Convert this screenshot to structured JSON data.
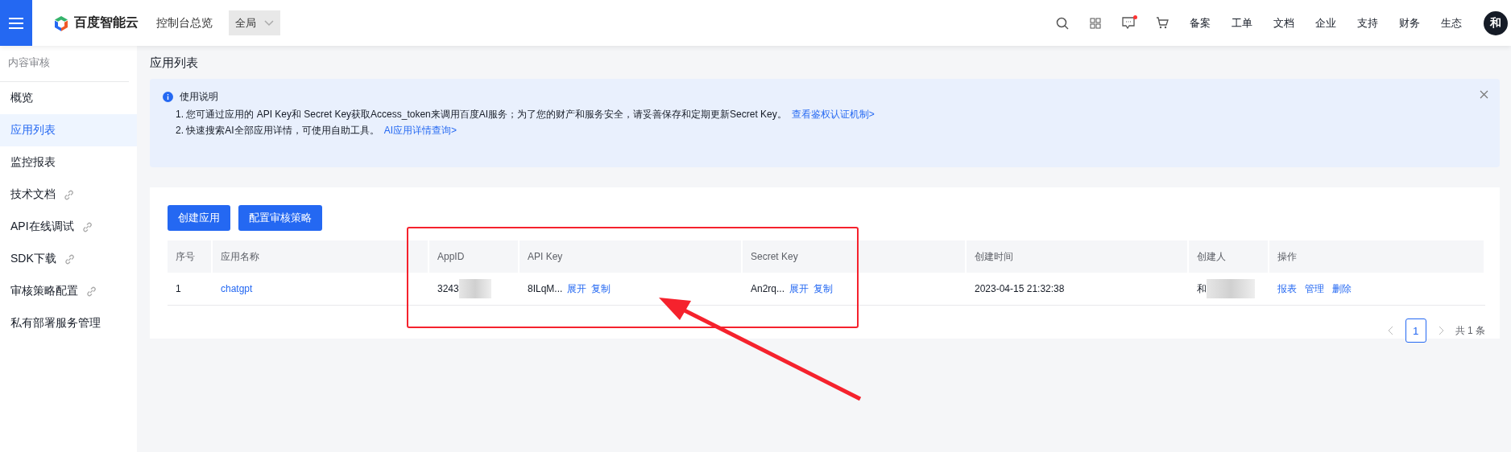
{
  "topbar": {
    "logo": "百度智能云",
    "console": "控制台总览",
    "region": {
      "value": "全局"
    },
    "notification_dot": true,
    "nav": [
      "备案",
      "工单",
      "文档",
      "企业",
      "支持",
      "财务",
      "生态"
    ],
    "avatar": "和"
  },
  "sidebar": {
    "title": "内容审核",
    "items": [
      {
        "label": "概览",
        "selected": false,
        "external": false
      },
      {
        "label": "应用列表",
        "selected": true,
        "external": false
      },
      {
        "label": "监控报表",
        "selected": false,
        "external": false
      },
      {
        "label": "技术文档",
        "selected": false,
        "external": true
      },
      {
        "label": "API在线调试",
        "selected": false,
        "external": true
      },
      {
        "label": "SDK下载",
        "selected": false,
        "external": true
      },
      {
        "label": "审核策略配置",
        "selected": false,
        "external": true
      },
      {
        "label": "私有部署服务管理",
        "selected": false,
        "external": false
      }
    ]
  },
  "page_title": "应用列表",
  "notice": {
    "title": "使用说明",
    "lines": [
      {
        "text": "1. 您可通过应用的 API Key和 Secret Key获取Access_token来调用百度AI服务；为了您的财产和服务安全，请妥善保存和定期更新Secret Key。",
        "link": "查看鉴权认证机制>"
      },
      {
        "text": "2. 快速搜索AI全部应用详情，可使用自助工具。",
        "link": "AI应用详情查询>"
      }
    ]
  },
  "buttons": [
    "创建应用",
    "配置审核策略"
  ],
  "table": {
    "columns": [
      "序号",
      "应用名称",
      "AppID",
      "API Key",
      "Secret Key",
      "创建时间",
      "创建人",
      "操作"
    ],
    "rows": [
      {
        "index": "1",
        "name": "chatgpt",
        "app_id": "3243",
        "api_key": "8ILqM...",
        "api_key_actions": [
          "展开",
          "复制"
        ],
        "secret_key": "An2rq...",
        "secret_key_actions": [
          "展开",
          "复制"
        ],
        "created": "2023-04-15 21:32:38",
        "creator": "和",
        "actions": [
          "报表",
          "管理",
          "删除"
        ]
      }
    ]
  },
  "pagination": {
    "pages": [
      {
        "label": "1",
        "selected": true
      }
    ],
    "total": "共 1 条"
  }
}
